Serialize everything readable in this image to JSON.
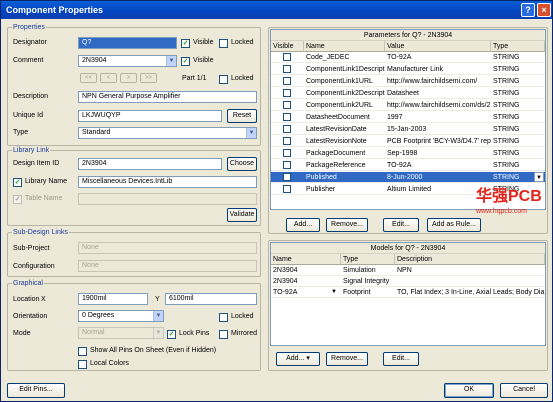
{
  "window": {
    "title": "Component Properties",
    "help": "?",
    "close": "×"
  },
  "properties": {
    "group_title": "Properties",
    "designator_label": "Designator",
    "designator_value": "Q?",
    "designator_visible_label": "Visible",
    "designator_locked_label": "Locked",
    "comment_label": "Comment",
    "comment_value": "2N3904",
    "comment_visible_label": "Visible",
    "part_label": "Part 1/1",
    "part_locked_label": "Locked",
    "nav_first": "<<",
    "nav_prev": "<",
    "nav_next": ">",
    "nav_last": ">>",
    "description_label": "Description",
    "description_value": "NPN General Purpose Amplifier",
    "unique_id_label": "Unique Id",
    "unique_id_value": "LKJWUQYP",
    "reset_button": "Reset",
    "type_label": "Type",
    "type_value": "Standard"
  },
  "library_link": {
    "group_title": "Library Link",
    "design_item_id_label": "Design Item ID",
    "design_item_id_value": "2N3904",
    "choose_button": "Choose",
    "library_name_label": "Library Name",
    "library_name_value": "Miscellaneous Devices.IntLib",
    "table_name_label": "Table Name",
    "validate_button": "Validate"
  },
  "sub_design": {
    "group_title": "Sub-Design Links",
    "sub_project_label": "Sub-Project",
    "sub_project_value": "None",
    "configuration_label": "Configuration",
    "configuration_value": "None"
  },
  "graphical": {
    "group_title": "Graphical",
    "location_label": "Location",
    "x_label": "X",
    "x_value": "1900mil",
    "y_label": "Y",
    "y_value": "6100mil",
    "orientation_label": "Orientation",
    "orientation_value": "0 Degrees",
    "locked_label": "Locked",
    "mode_label": "Mode",
    "mode_value": "Normal",
    "lock_pins_label": "Lock Pins",
    "mirrored_label": "Mirrored",
    "show_all_pins_label": "Show All Pins On Sheet (Even if Hidden)",
    "local_colors_label": "Local Colors"
  },
  "parameters": {
    "title": "Parameters for Q? - 2N3904",
    "columns": [
      "Visible",
      "Name",
      "Value",
      "Type"
    ],
    "rows": [
      {
        "name": "Code_JEDEC",
        "value": "TO-92A",
        "type": "STRING"
      },
      {
        "name": "ComponentLink1Descriptio",
        "value": "Manufacturer Link",
        "type": "STRING"
      },
      {
        "name": "ComponentLink1URL",
        "value": "http://www.fairchildsemi.com/",
        "type": "STRING"
      },
      {
        "name": "ComponentLink2Descriptio",
        "value": "Datasheet",
        "type": "STRING"
      },
      {
        "name": "ComponentLink2URL",
        "value": "http://www.fairchildsemi.com/ds/2",
        "type": "STRING"
      },
      {
        "name": "DatasheetDocument",
        "value": "1997",
        "type": "STRING"
      },
      {
        "name": "LatestRevisionDate",
        "value": "15-Jan-2003",
        "type": "STRING"
      },
      {
        "name": "LatestRevisionNote",
        "value": "PCB Footprint 'BCY-W3/D4.7' replac",
        "type": "STRING"
      },
      {
        "name": "PackageDocument",
        "value": "Sep-1998",
        "type": "STRING"
      },
      {
        "name": "PackageReference",
        "value": "TO-92A",
        "type": "STRING"
      },
      {
        "name": "Published",
        "value": "8-Jun-2000",
        "type": "STRING"
      },
      {
        "name": "Publisher",
        "value": "Altium Limited",
        "type": "STRING"
      }
    ],
    "add_button": "Add...",
    "remove_button": "Remove...",
    "edit_button": "Edit...",
    "add_as_rule_button": "Add as Rule..."
  },
  "models": {
    "title": "Models for Q? - 2N3904",
    "columns": [
      "Name",
      "Type",
      "Description"
    ],
    "rows": [
      {
        "name": "2N3904",
        "type": "Simulation",
        "description": "NPN"
      },
      {
        "name": "2N3904",
        "type": "Signal Integrity",
        "description": ""
      },
      {
        "name": "TO-92A",
        "type": "Footprint",
        "description": "TO, Flat Index; 3 In-Line, Axial Leads; Body Dia. 4."
      }
    ],
    "add_button": "Add...",
    "remove_button": "Remove...",
    "edit_button": "Edit..."
  },
  "footer": {
    "edit_pins_button": "Edit Pins...",
    "ok_button": "OK",
    "cancel_button": "Cancel"
  },
  "watermark": {
    "main": "华强PCB",
    "sub": "www.hqpcb.com"
  }
}
